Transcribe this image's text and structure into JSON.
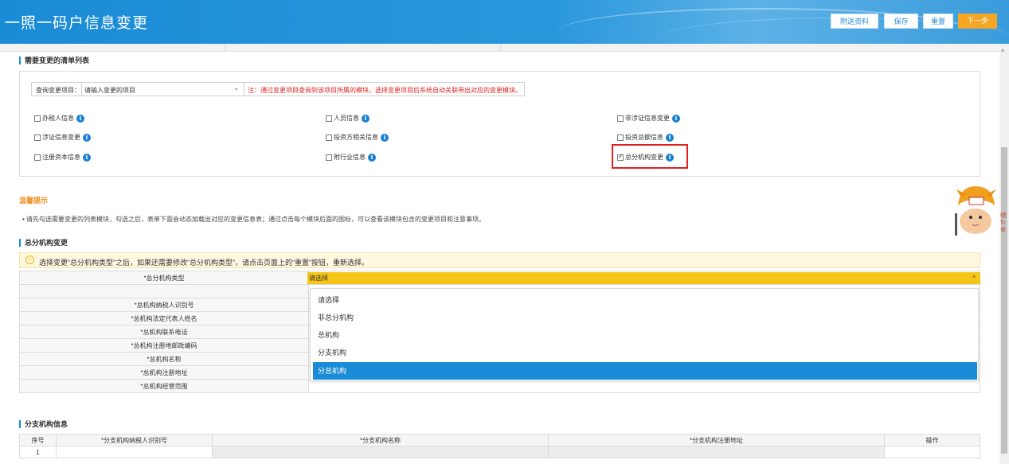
{
  "header": {
    "title": "一照一码户信息变更",
    "buttons": {
      "attach": "附送资料",
      "save": "保存",
      "reset": "重置",
      "next": "下一步"
    }
  },
  "list_section": {
    "title": "需要变更的清单列表",
    "query_label": "查询变更项目：",
    "query_placeholder": "请输入变更的项目",
    "query_note": "注：通过变更项目查询到该项目所属的模块，选择变更项目后系统自动关联带出对应的变更模块。",
    "checkboxes": [
      {
        "label": "办税人信息",
        "checked": false
      },
      {
        "label": "人员信息",
        "checked": false
      },
      {
        "label": "非涉证信息变更",
        "checked": false
      },
      {
        "label": "涉证信息变更",
        "checked": false
      },
      {
        "label": "投资方相关信息",
        "checked": false
      },
      {
        "label": "投资总额信息",
        "checked": false
      },
      {
        "label": "注册资本信息",
        "checked": false
      },
      {
        "label": "附行业信息",
        "checked": false
      },
      {
        "label": "总分机构变更",
        "checked": true
      }
    ]
  },
  "tips": {
    "title": "温馨提示",
    "text": "• 请先勾选需要变更的列表模块，勾选之后，表单下面会动态加载出对应的变更信息表；通过点击每个模块后面的图标，可以查看该模块包含的变更项目和注意事项。"
  },
  "branch_change": {
    "title": "总分机构变更",
    "warning": "选择变更“总分机构类型”之后，如果还需要修改“总分机构类型”，请点击页面上的“重置”按钮，重新选择。",
    "type_label": "*总分机构类型",
    "type_value": "请选择",
    "rows": [
      "",
      "*总机构纳税人识别号",
      "*总机构法定代表人姓名",
      "*总机构联系电话",
      "*总机构注册地邮政编码",
      "*总机构名称",
      "*总机构注册地址",
      "*总机构经营范围"
    ],
    "dropdown_options": [
      "请选择",
      "非总分机构",
      "总机构",
      "分支机构",
      "分总机构"
    ],
    "dropdown_selected_index": 4
  },
  "branch_info": {
    "title": "分支机构信息",
    "headers": [
      "序号",
      "*分支机构纳税人识别号",
      "*分支机构名称",
      "*分支机构注册地址",
      "操作"
    ],
    "rows": [
      [
        "1",
        "",
        "",
        "",
        ""
      ]
    ]
  },
  "side": {
    "label": "帧"
  },
  "colors": {
    "primary": "#1a8bd6",
    "accent": "#f5a623",
    "select_highlight": "#f5c518",
    "required": "#e02020"
  }
}
